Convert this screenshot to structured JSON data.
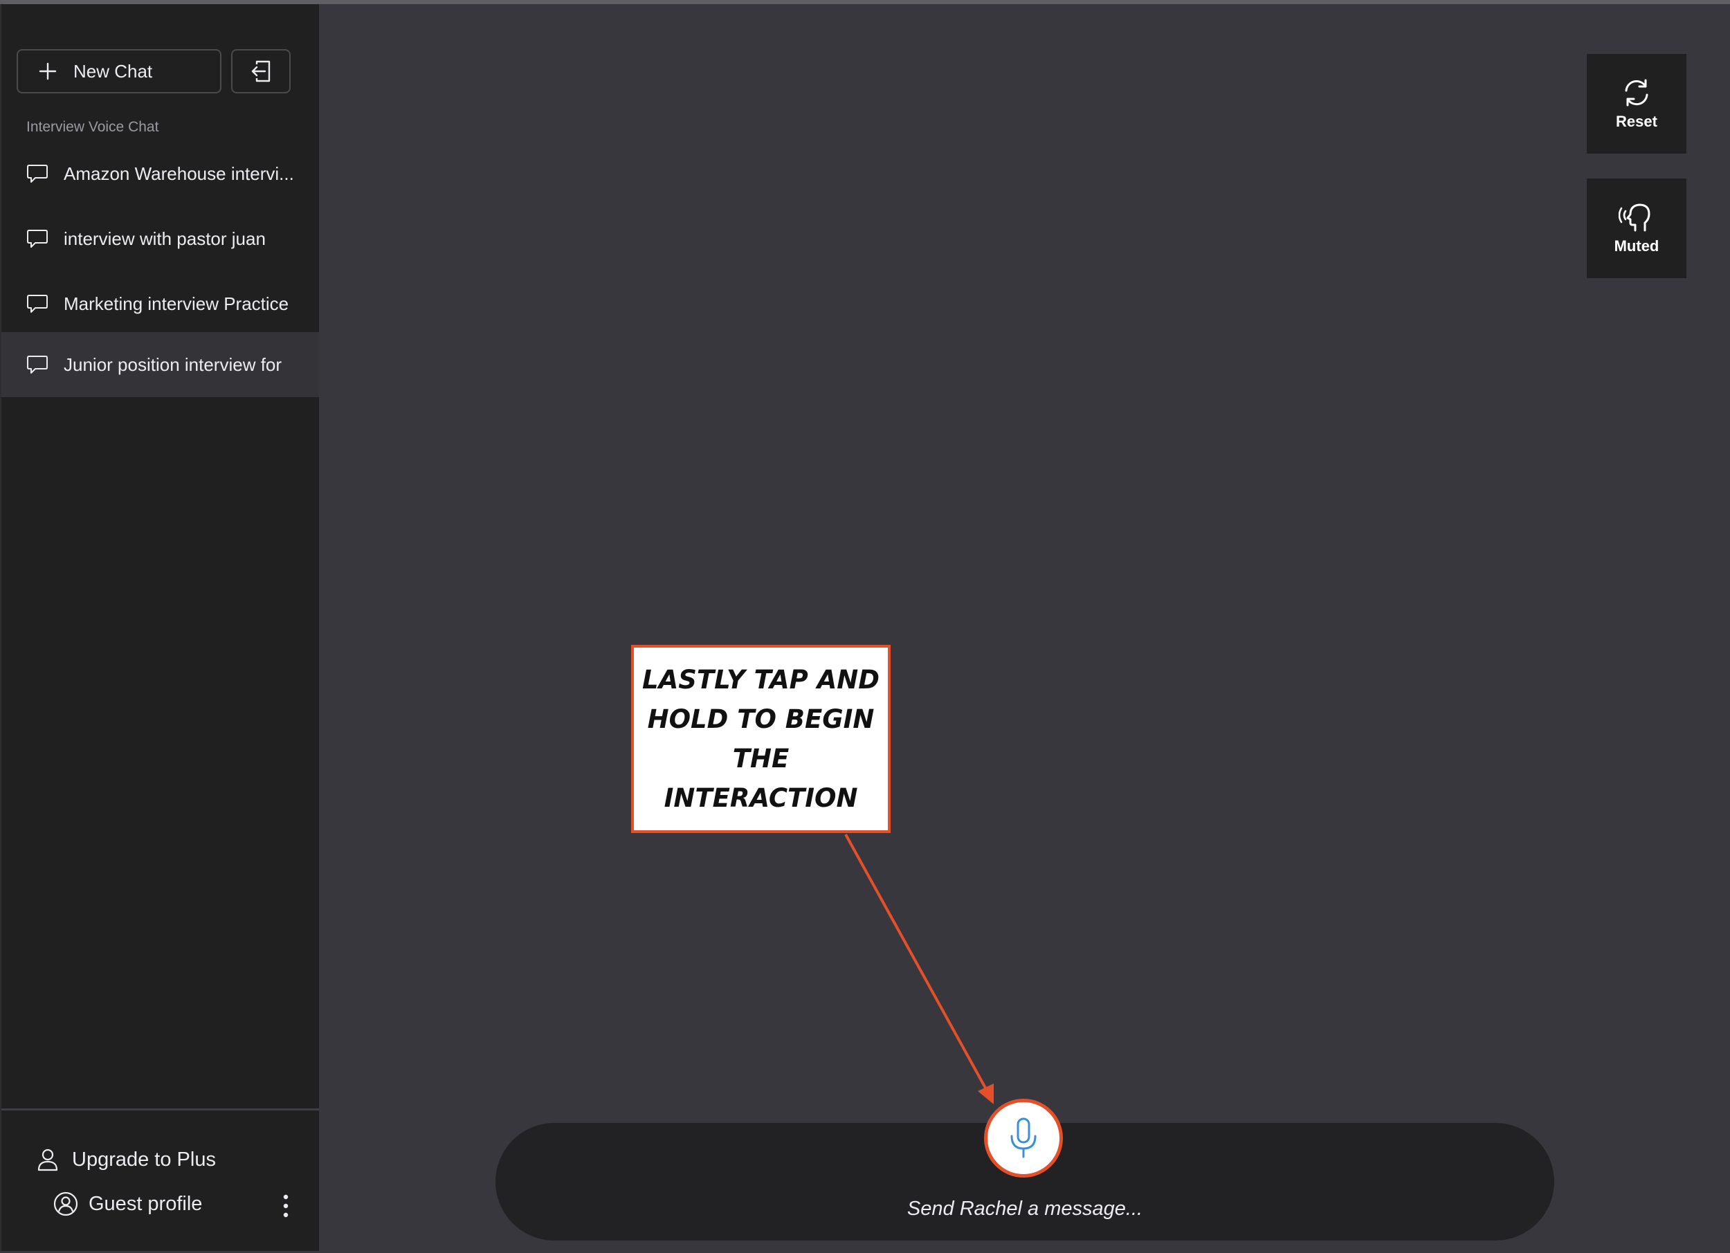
{
  "sidebar": {
    "new_chat_label": "New Chat",
    "section_title": "Interview Voice Chat",
    "chats": [
      {
        "label": "Amazon Warehouse intervi..."
      },
      {
        "label": "interview with pastor juan"
      },
      {
        "label": "Marketing interview Practice"
      },
      {
        "label": "Junior position interview for"
      }
    ],
    "footer": {
      "upgrade_label": "Upgrade to Plus",
      "profile_label": "Guest profile"
    }
  },
  "controls": {
    "reset_label": "Reset",
    "muted_label": "Muted"
  },
  "annotation": {
    "text": "LASTLY TAP AND HOLD TO BEGIN THE INTERACTION",
    "accent_color": "#e4502a"
  },
  "composer": {
    "placeholder": "Send Rachel a message..."
  },
  "icons": [
    "plus-icon",
    "exit-icon",
    "chat-bubble-icon",
    "user-icon",
    "user-circle-icon",
    "kebab-icon",
    "refresh-icon",
    "speaking-head-icon",
    "microphone-icon"
  ]
}
